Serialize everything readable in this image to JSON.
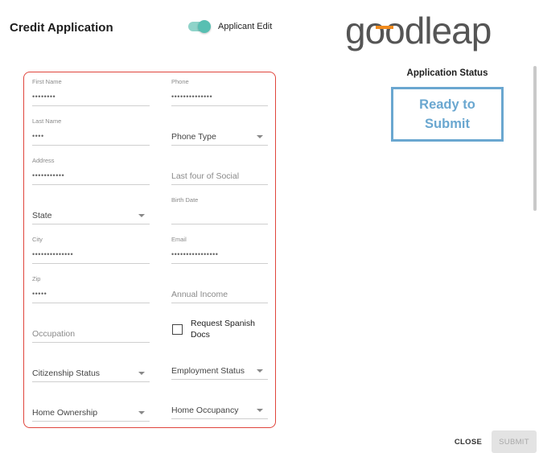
{
  "header": {
    "title": "Credit Application",
    "toggle_label": "Applicant Edit",
    "logo_text": "goodleap"
  },
  "form": {
    "first_name": {
      "label": "First Name",
      "value": "••••••••"
    },
    "phone": {
      "label": "Phone",
      "value": "••••••••••••••"
    },
    "last_name": {
      "label": "Last Name",
      "value": "••••"
    },
    "phone_type": {
      "label": "Phone Type"
    },
    "address": {
      "label": "Address",
      "value": "•••••••••••"
    },
    "last_four_social": {
      "placeholder": "Last four of Social"
    },
    "state": {
      "label": "State"
    },
    "birth_date": {
      "label": "Birth Date"
    },
    "city": {
      "label": "City",
      "value": "••••••••••••••"
    },
    "email": {
      "label": "Email",
      "value": "••••••••••••••••"
    },
    "zip": {
      "label": "Zip",
      "value": "•••••"
    },
    "annual_income": {
      "placeholder": "Annual Income"
    },
    "occupation": {
      "placeholder": "Occupation"
    },
    "request_spanish_docs": {
      "label": "Request Spanish Docs",
      "checked": false
    },
    "citizenship_status": {
      "label": "Citizenship Status"
    },
    "employment_status": {
      "label": "Employment Status"
    },
    "home_ownership": {
      "label": "Home Ownership"
    },
    "home_occupancy": {
      "label": "Home Occupancy"
    }
  },
  "status": {
    "title": "Application Status",
    "value": "Ready to Submit"
  },
  "footer": {
    "close_label": "CLOSE",
    "submit_label": "SUBMIT"
  },
  "colors": {
    "form_border": "#e0453c",
    "status_accent": "#6aa7d0",
    "toggle_accent": "#58bfb2",
    "logo_gray": "#555555",
    "logo_orange": "#f08a1c"
  }
}
